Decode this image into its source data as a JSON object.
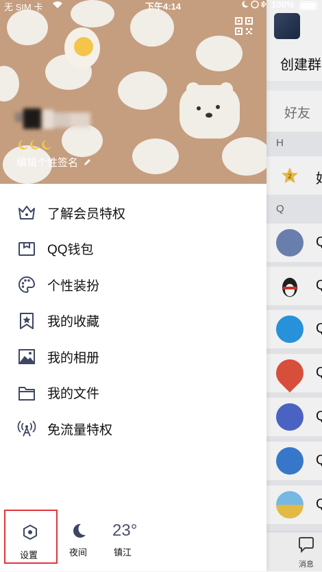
{
  "status_bar": {
    "carrier": "无 SIM 卡",
    "time": "下午4:14",
    "battery": "100%"
  },
  "profile": {
    "signature": "编辑个性签名"
  },
  "menu": {
    "items": [
      {
        "label": "了解会员特权",
        "icon": "crown-icon"
      },
      {
        "label": "QQ钱包",
        "icon": "wallet-icon"
      },
      {
        "label": "个性装扮",
        "icon": "palette-icon"
      },
      {
        "label": "我的收藏",
        "icon": "bookmark-star-icon"
      },
      {
        "label": "我的相册",
        "icon": "album-icon"
      },
      {
        "label": "我的文件",
        "icon": "folder-icon"
      },
      {
        "label": "免流量特权",
        "icon": "signal-tower-icon"
      }
    ]
  },
  "bottom": {
    "settings_label": "设置",
    "night_label": "夜间",
    "temperature": "23°",
    "city": "镇江"
  },
  "background_page": {
    "create_group": "创建群",
    "friends_tab": "好友",
    "section_h": "H",
    "section_q": "Q",
    "row_h_letter": "好",
    "row_letter": "Q",
    "messages_tab": "消息"
  },
  "colors": {
    "cover_bg": "#c59e7f",
    "highlight_border": "#e0353a",
    "icon_stroke": "#3d4663"
  }
}
